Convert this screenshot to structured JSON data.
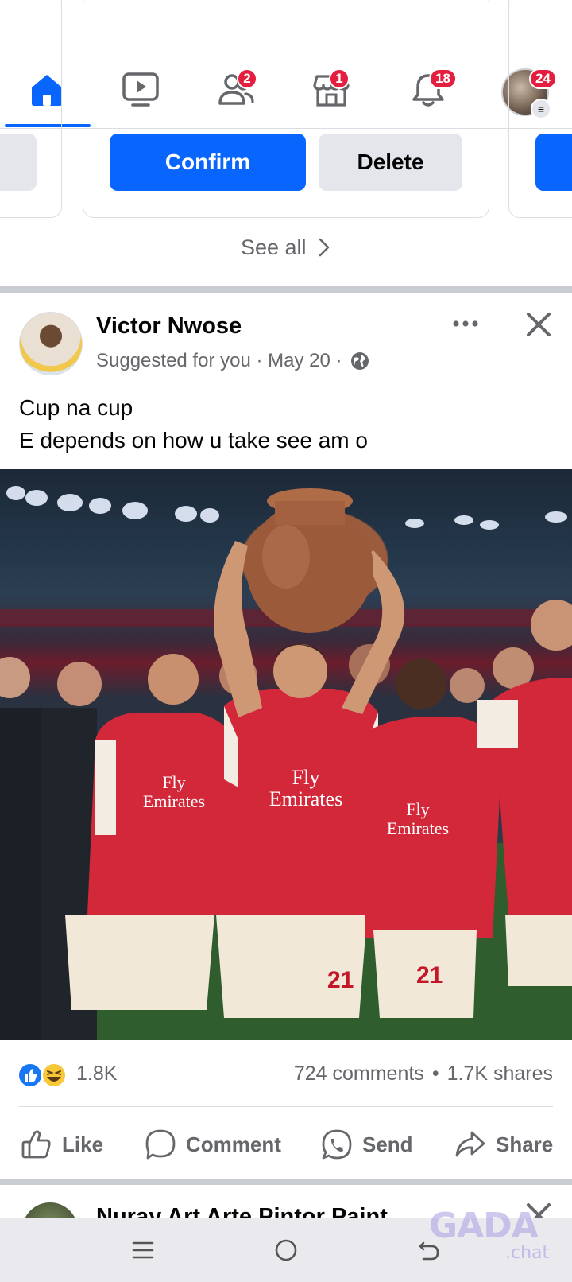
{
  "topnav": {
    "items": [
      {
        "name": "home",
        "badge": null
      },
      {
        "name": "video",
        "badge": null
      },
      {
        "name": "friends",
        "badge": "2"
      },
      {
        "name": "marketplace",
        "badge": "1"
      },
      {
        "name": "notifications",
        "badge": "18"
      },
      {
        "name": "profile-menu",
        "badge": "24"
      }
    ],
    "active": "home",
    "accent_color": "#0866ff",
    "badge_color": "#e41e3f"
  },
  "friend_requests": {
    "confirm_label": "Confirm",
    "delete_label": "Delete",
    "see_all_label": "See all"
  },
  "post": {
    "author": "Victor Nwose",
    "meta": "Suggested for you · May 20 ·",
    "privacy_icon": "globe-icon",
    "text_line1": "Cup na cup",
    "text_line2": "E depends on how u take see am o",
    "image_alt": "Football players in red and white kits celebrating while one holds up a clay pot",
    "shirt_text": "Fly Emirates",
    "shirt_number": "21",
    "reactions": {
      "icons": [
        "like-icon",
        "haha-icon"
      ],
      "count": "1.8K",
      "comments": "724 comments",
      "separator": "•",
      "shares": "1.7K shares"
    },
    "actions": {
      "like": "Like",
      "comment": "Comment",
      "send": "Send",
      "share": "Share"
    }
  },
  "next_post": {
    "author": "Nuray Art Arte Pintor Paint"
  },
  "watermark": {
    "brand": "GADA",
    "sub": ".chat"
  }
}
